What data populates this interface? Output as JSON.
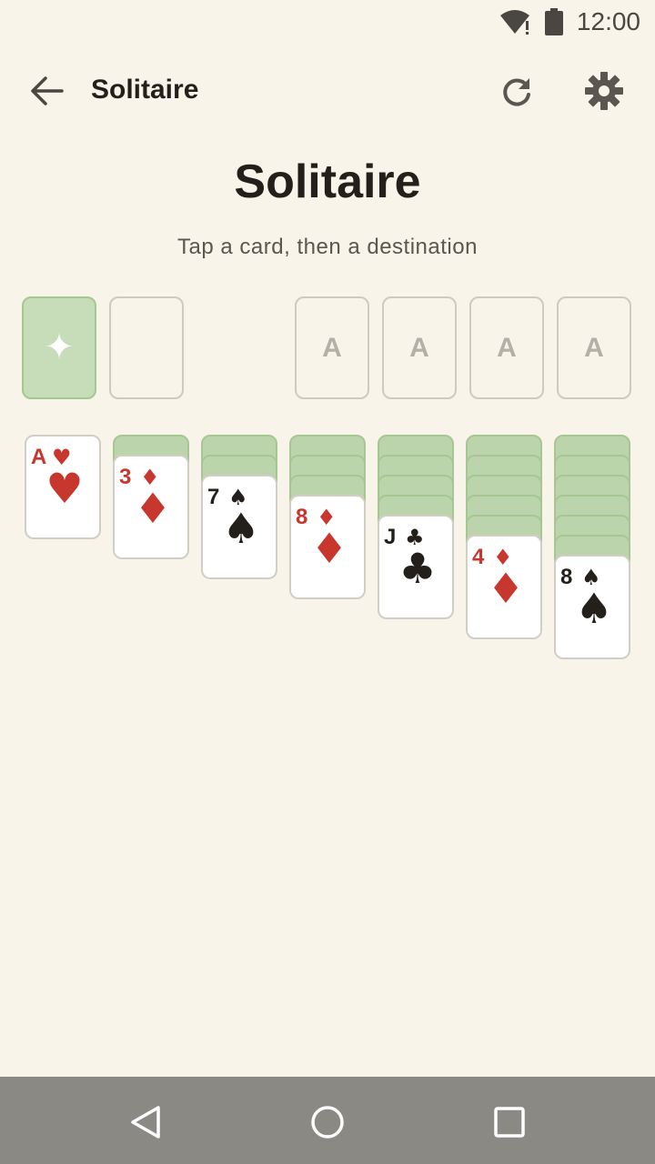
{
  "status": {
    "time": "12:00",
    "icons": [
      "wifi-alert-icon",
      "battery-icon"
    ]
  },
  "app_bar": {
    "title": "Solitaire",
    "icons": [
      "back-arrow-icon",
      "restart-icon",
      "gear-icon"
    ]
  },
  "heading": "Solitaire",
  "subtitle": "Tap a card, then a destination",
  "stock": {
    "symbol": "✦"
  },
  "foundations": [
    "A",
    "A",
    "A",
    "A"
  ],
  "tableau": [
    {
      "facedown": 0,
      "card": {
        "rank": "A",
        "suit": "♥",
        "color": "red"
      }
    },
    {
      "facedown": 1,
      "card": {
        "rank": "3",
        "suit": "♦",
        "color": "red"
      }
    },
    {
      "facedown": 2,
      "card": {
        "rank": "7",
        "suit": "♠",
        "color": "black"
      }
    },
    {
      "facedown": 3,
      "card": {
        "rank": "8",
        "suit": "♦",
        "color": "red"
      }
    },
    {
      "facedown": 4,
      "card": {
        "rank": "J",
        "suit": "♣",
        "color": "black"
      }
    },
    {
      "facedown": 5,
      "card": {
        "rank": "4",
        "suit": "♦",
        "color": "red"
      }
    },
    {
      "facedown": 6,
      "card": {
        "rank": "8",
        "suit": "♠",
        "color": "black"
      }
    }
  ],
  "facedown_pip": "◆",
  "colors": {
    "background": "#f8f4ea",
    "card_back": "#bcd4ab",
    "red_suit": "#c8372d",
    "black_suit": "#231f1a",
    "nav_bar": "#8b8984"
  },
  "nav": [
    "back-triangle-icon",
    "home-circle-icon",
    "recents-square-icon"
  ]
}
